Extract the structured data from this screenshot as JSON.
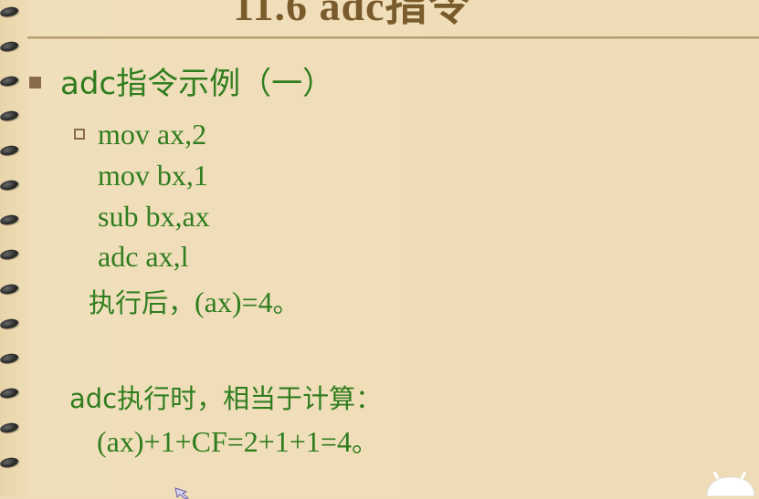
{
  "slide": {
    "title": "11.6 adc指令",
    "heading": "adc指令示例（一）",
    "code_lines": [
      "mov ax,2",
      "mov bx,1",
      "sub bx,ax",
      "adc ax,l"
    ],
    "result_prefix": "执行后，",
    "result_expr": "(ax)=4",
    "result_suffix": "。",
    "explain_line": "adc执行时，相当于计算：",
    "formula_expr": "(ax)+1+CF=2+1+1=4",
    "formula_suffix": "。"
  },
  "colors": {
    "background": "#efdcb7",
    "text_green": "#2f7d1e",
    "bullet_brown": "#8b6c4a",
    "title_brown": "#7a5b2b"
  },
  "icons": {
    "binding": "spiral-binding-ring",
    "cursor": "cursor-icon",
    "corner": "mascot-icon"
  }
}
